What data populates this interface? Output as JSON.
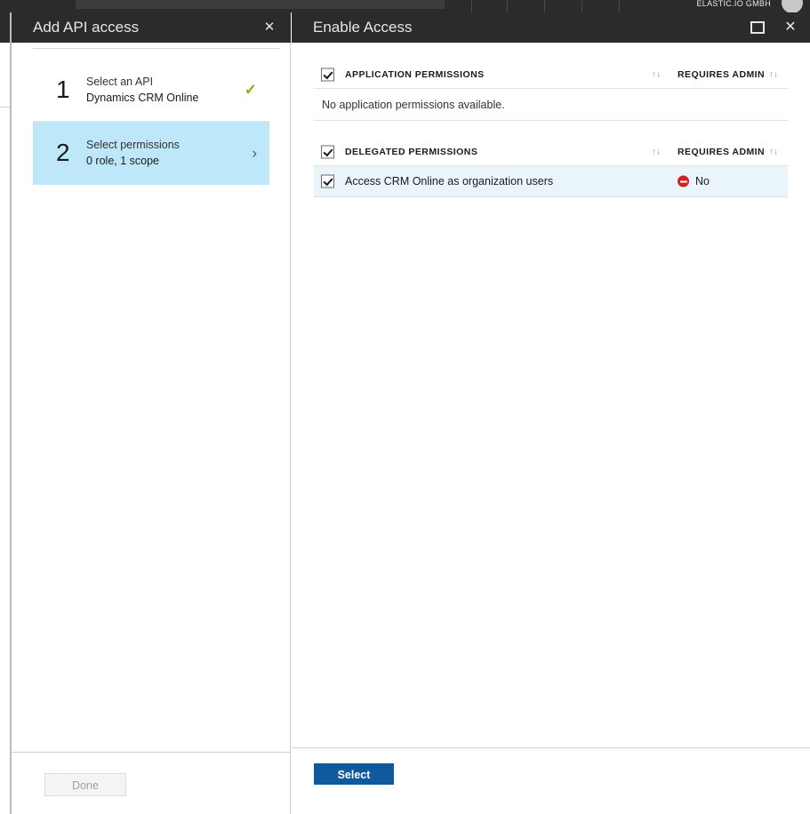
{
  "topnav": {
    "tenant": "ELASTIC.IO GMBH",
    "search_placeholder": "",
    "avatar_name": "user-avatar"
  },
  "blade_add_api": {
    "title": "Add API access",
    "close_label": "✕",
    "steps": [
      {
        "number": "1",
        "title": "Select an API",
        "subtitle": "Dynamics CRM Online",
        "state": "complete",
        "marker": "✓"
      },
      {
        "number": "2",
        "title": "Select permissions",
        "subtitle": "0 role, 1 scope",
        "state": "active",
        "marker": "›"
      }
    ],
    "footer": {
      "done_label": "Done",
      "done_disabled": true
    }
  },
  "blade_enable_access": {
    "title": "Enable Access",
    "maximize_label": "maximize",
    "close_label": "✕",
    "sections": [
      {
        "header_label": "APPLICATION PERMISSIONS",
        "admin_label": "REQUIRES ADMIN",
        "sort_glyph": "↑↓",
        "checkbox_checked": true,
        "empty_message": "No application permissions available.",
        "rows": []
      },
      {
        "header_label": "DELEGATED PERMISSIONS",
        "admin_label": "REQUIRES ADMIN",
        "sort_glyph": "↑↓",
        "checkbox_checked": true,
        "empty_message": "",
        "rows": [
          {
            "label": "Access CRM Online as organization users",
            "requires_admin": "No",
            "checked": true,
            "status_icon": "no-entry-icon"
          }
        ]
      }
    ],
    "footer": {
      "select_label": "Select"
    }
  },
  "colors": {
    "header_bg": "#2b2b2b",
    "accent_blue": "#11599f",
    "active_step_bg": "#bfe7fa",
    "row_selected_bg": "#eaf5fb",
    "check_green": "#7fba00",
    "deny_red": "#d32121"
  }
}
